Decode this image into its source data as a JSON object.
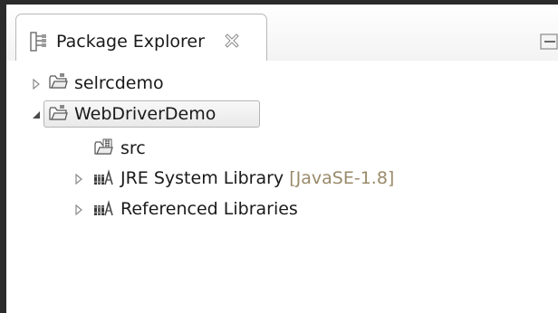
{
  "view": {
    "title": "Package Explorer",
    "title_icon": "package-explorer-icon",
    "close_icon": "close-icon",
    "minimize_icon": "minimize-icon"
  },
  "tree": {
    "items": [
      {
        "label": "selrcdemo",
        "icon": "project-folder-icon",
        "expanded": false,
        "selected": false
      },
      {
        "label": "WebDriverDemo",
        "icon": "project-folder-icon",
        "expanded": true,
        "selected": true
      },
      {
        "label": "src",
        "icon": "source-folder-icon"
      },
      {
        "label": "JRE System Library",
        "suffix": "[JavaSE-1.8]",
        "icon": "library-icon",
        "expanded": false
      },
      {
        "label": "Referenced Libraries",
        "icon": "library-icon",
        "expanded": false
      }
    ]
  },
  "colors": {
    "border_dark": "#2b2b2b",
    "suffix_text": "#9a8a6a",
    "selection_border": "#b5b5b5"
  }
}
